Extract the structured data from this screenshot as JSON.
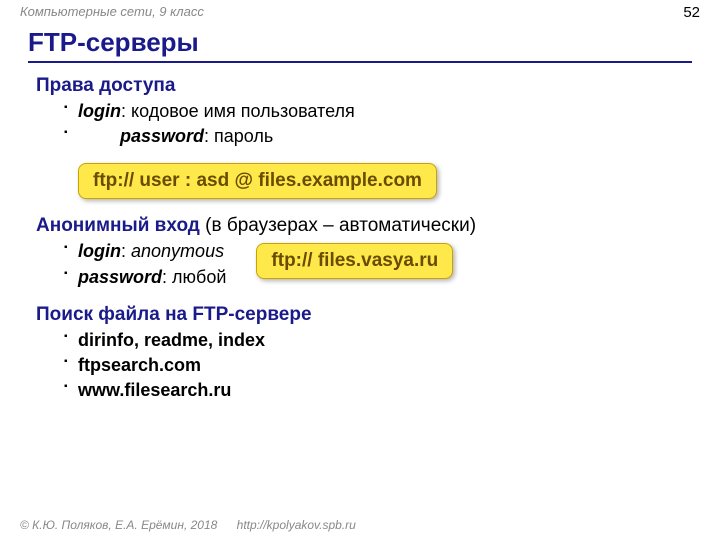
{
  "header": {
    "course": "Компьютерные сети, 9 класс",
    "page": "52"
  },
  "title": "FTP-серверы",
  "s1": {
    "heading": "Права доступа",
    "li1_label": "login",
    "li1_rest": ": кодовое имя пользователя",
    "li2_label": "password",
    "li2_rest": ": пароль"
  },
  "callout1": "ftp:// user : asd @ files.example.com",
  "s2": {
    "heading": "Анонимный вход",
    "heading_rest": " (в браузерах – автоматически)",
    "li1_label": "login",
    "li1_sep": ": ",
    "li1_val": "anonymous",
    "li2_label": "password",
    "li2_rest": ": любой"
  },
  "callout2": "ftp:// files.vasya.ru",
  "s3": {
    "heading": "Поиск файла на FTP-сервере",
    "li1": "dirinfo, readme, index",
    "li2": "ftpsearch.com",
    "li3": "www.filesearch.ru"
  },
  "footer": {
    "copy": "© К.Ю. Поляков, Е.А. Ерёмин, 2018",
    "url": "http://kpolyakov.spb.ru"
  }
}
